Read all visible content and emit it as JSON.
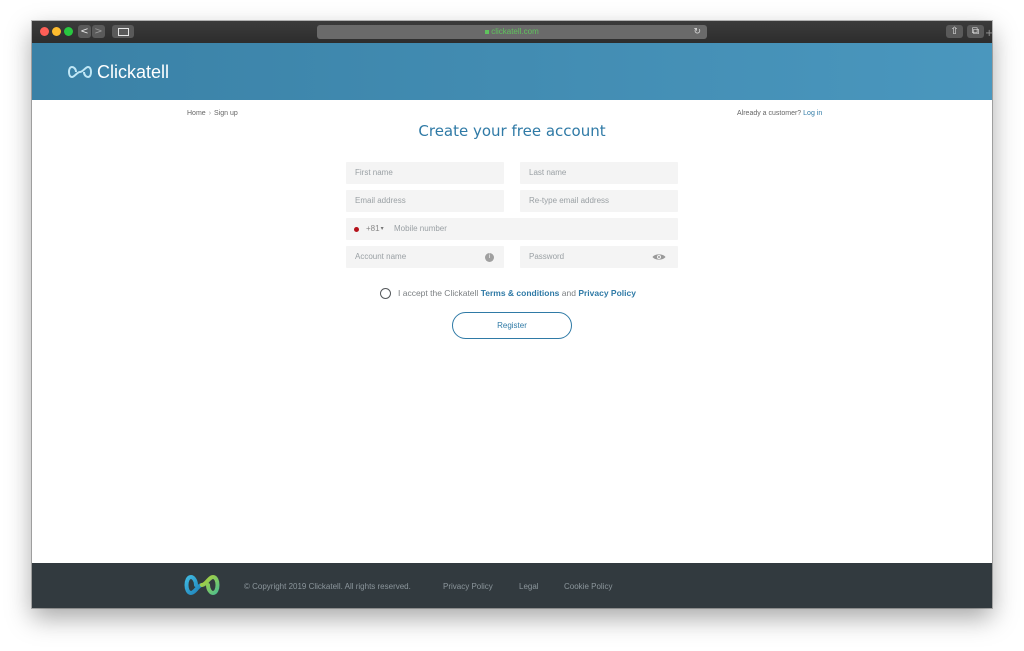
{
  "browser": {
    "url": "clickatell.com",
    "back_glyph": "<",
    "forward_glyph": ">",
    "reload_glyph": "↻",
    "share_glyph": "⇧",
    "tabs_glyph": "⧉",
    "new_tab_glyph": "+"
  },
  "header": {
    "brand": "Clickatell",
    "colors": {
      "start": "#3a81a6",
      "end": "#4a97be"
    }
  },
  "breadcrumb": {
    "home": "Home",
    "separator": "›",
    "current": "Sign up"
  },
  "login_prompt": {
    "text": "Already a customer?",
    "link": "Log in"
  },
  "title": "Create your free account",
  "form": {
    "first_name": "First name",
    "last_name": "Last name",
    "email": "Email address",
    "retype_email": "Re-type email address",
    "country_code": "+81",
    "mobile": "Mobile number",
    "account_name": "Account name",
    "password": "Password",
    "info_glyph": "i"
  },
  "terms": {
    "prefix": "I accept the Clickatell ",
    "terms_link": "Terms & conditions",
    "and": " and ",
    "privacy_link": "Privacy Policy"
  },
  "register_label": "Register",
  "footer": {
    "copyright": "© Copyright 2019 Clickatell. All rights reserved.",
    "links": [
      "Privacy Policy",
      "Legal",
      "Cookie Policy"
    ]
  },
  "colors": {
    "accent": "#2f7aa6",
    "footer_bg": "#323a3f"
  }
}
